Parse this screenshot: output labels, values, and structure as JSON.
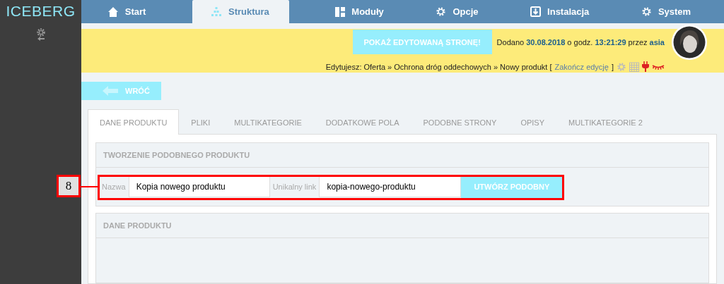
{
  "sidebar": {
    "logo": "ICEBERG"
  },
  "nav": {
    "items": [
      {
        "label": "Start",
        "selected": false
      },
      {
        "label": "Struktura",
        "selected": true
      },
      {
        "label": "Moduły",
        "selected": false
      },
      {
        "label": "Opcje",
        "selected": false
      },
      {
        "label": "Instalacja",
        "selected": false
      },
      {
        "label": "System",
        "selected": false
      }
    ]
  },
  "banner": {
    "show_button": "POKAŻ EDYTOWANĄ STRONĘ!",
    "added_label": "Dodano",
    "date": "30.08.2018",
    "at_label": "o godz.",
    "time": "13:21:29",
    "by_label": "przez",
    "user": "asia",
    "editing_label": "Edytujesz:",
    "crumbs": [
      "Oferta",
      "Ochrona dróg oddechowych",
      "Nowy produkt"
    ],
    "separator": "»",
    "bracket_open": "[",
    "end_edit": "Zakończ edycję",
    "bracket_close": "]"
  },
  "back_button": "WRÓĆ",
  "tabs": [
    {
      "label": "DANE PRODUKTU",
      "selected": true
    },
    {
      "label": "PLIKI",
      "selected": false
    },
    {
      "label": "MULTIKATEGORIE",
      "selected": false
    },
    {
      "label": "DODATKOWE POLA",
      "selected": false
    },
    {
      "label": "PODOBNE STRONY",
      "selected": false
    },
    {
      "label": "OPISY",
      "selected": false
    },
    {
      "label": "MULTIKATEGORIE 2",
      "selected": false
    }
  ],
  "copy_section": {
    "title": "TWORZENIE PODOBNEGO PRODUKTU",
    "name_label": "Nazwa",
    "name_value": "Kopia nowego produktu",
    "link_label": "Unikalny link",
    "link_value": "kopia-nowego-produktu",
    "button": "UTWÓRZ PODOBNY"
  },
  "annotation": {
    "number": "8"
  },
  "product_section": {
    "title": "DANE PRODUKTU"
  }
}
